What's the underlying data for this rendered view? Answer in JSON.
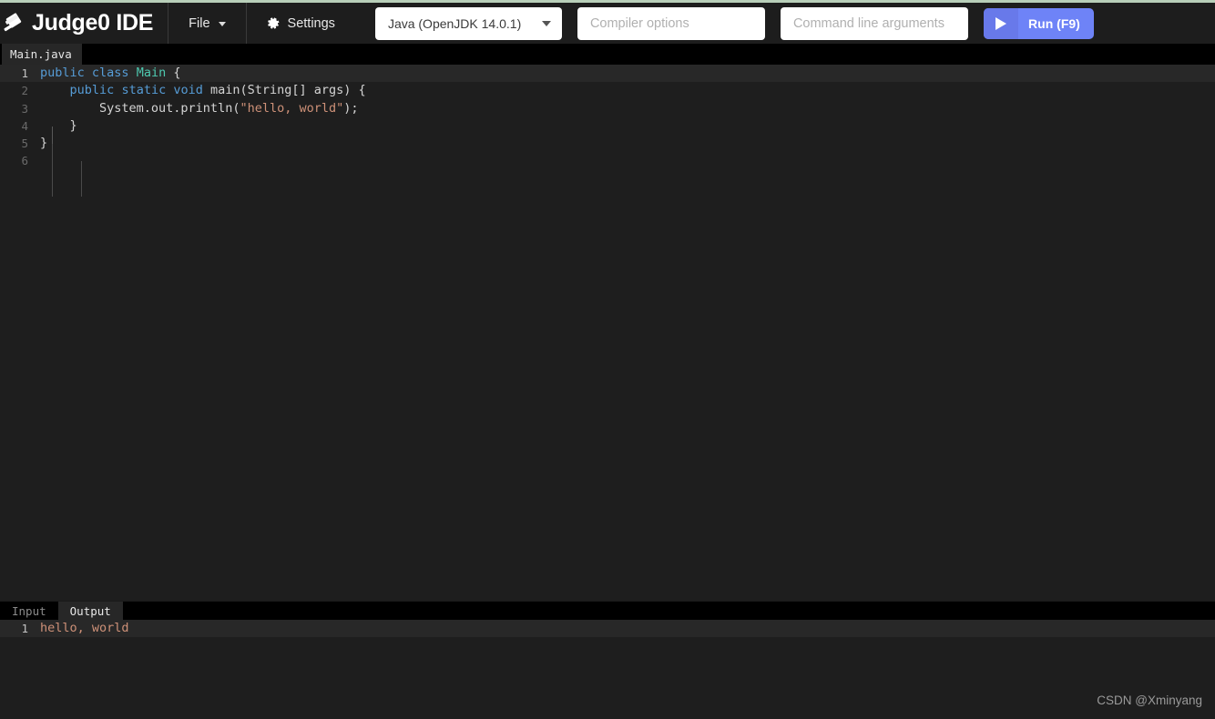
{
  "app": {
    "title": "Judge0 IDE",
    "logo_icon": "gavel-icon",
    "accent_color": "#6e83f7",
    "top_rule_color": "#b8cfb9",
    "editor_bg": "#1e1e1e",
    "watermark": "CSDN @Xminyang"
  },
  "navbar": {
    "file_label": "File",
    "file_caret_icon": "chevron-down-icon",
    "settings_label": "Settings",
    "settings_icon": "gear-icon",
    "language": {
      "selected": "Java (OpenJDK 14.0.1)",
      "caret_icon": "chevron-down-icon"
    },
    "compiler_options": {
      "value": "",
      "placeholder": "Compiler options"
    },
    "command_line_arguments": {
      "value": "",
      "placeholder": "Command line arguments"
    },
    "run_button": {
      "label": "Run (F9)",
      "icon": "play-icon"
    }
  },
  "editor": {
    "tabs": [
      {
        "label": "Main.java",
        "active": true
      }
    ],
    "active_line": 1,
    "lines": [
      {
        "number": "1",
        "tokens": [
          {
            "t": "public",
            "c": "kw"
          },
          {
            "t": " ",
            "c": "pln"
          },
          {
            "t": "class",
            "c": "kw"
          },
          {
            "t": " ",
            "c": "pln"
          },
          {
            "t": "Main",
            "c": "typ"
          },
          {
            "t": " {",
            "c": "pln"
          }
        ]
      },
      {
        "number": "2",
        "tokens": [
          {
            "t": "    ",
            "c": "pln"
          },
          {
            "t": "public",
            "c": "kw"
          },
          {
            "t": " ",
            "c": "pln"
          },
          {
            "t": "static",
            "c": "kw"
          },
          {
            "t": " ",
            "c": "pln"
          },
          {
            "t": "void",
            "c": "kw"
          },
          {
            "t": " main(String[] args) {",
            "c": "pln"
          }
        ]
      },
      {
        "number": "3",
        "tokens": [
          {
            "t": "        System.out.println(",
            "c": "pln"
          },
          {
            "t": "\"hello, world\"",
            "c": "str"
          },
          {
            "t": ");",
            "c": "pln"
          }
        ]
      },
      {
        "number": "4",
        "tokens": [
          {
            "t": "    }",
            "c": "pln"
          }
        ]
      },
      {
        "number": "5",
        "tokens": [
          {
            "t": "}",
            "c": "pln"
          }
        ]
      },
      {
        "number": "6",
        "tokens": []
      }
    ],
    "plain_text": "public class Main {\n    public static void main(String[] args) {\n        System.out.println(\"hello, world\");\n    }\n}\n"
  },
  "io_panel": {
    "tabs": [
      {
        "label": "Input",
        "active": false
      },
      {
        "label": "Output",
        "active": true
      }
    ],
    "output": {
      "lines": [
        {
          "number": "1",
          "text": "hello, world"
        }
      ]
    },
    "input": {
      "lines": [
        {
          "number": "1",
          "text": ""
        }
      ]
    }
  },
  "colors": {
    "keyword": "#569cd6",
    "type": "#4ec9b0",
    "string": "#ce9178",
    "plain": "#d4d4d4",
    "gutter": "#6a6a6a",
    "active_line_bg": "#282828"
  }
}
